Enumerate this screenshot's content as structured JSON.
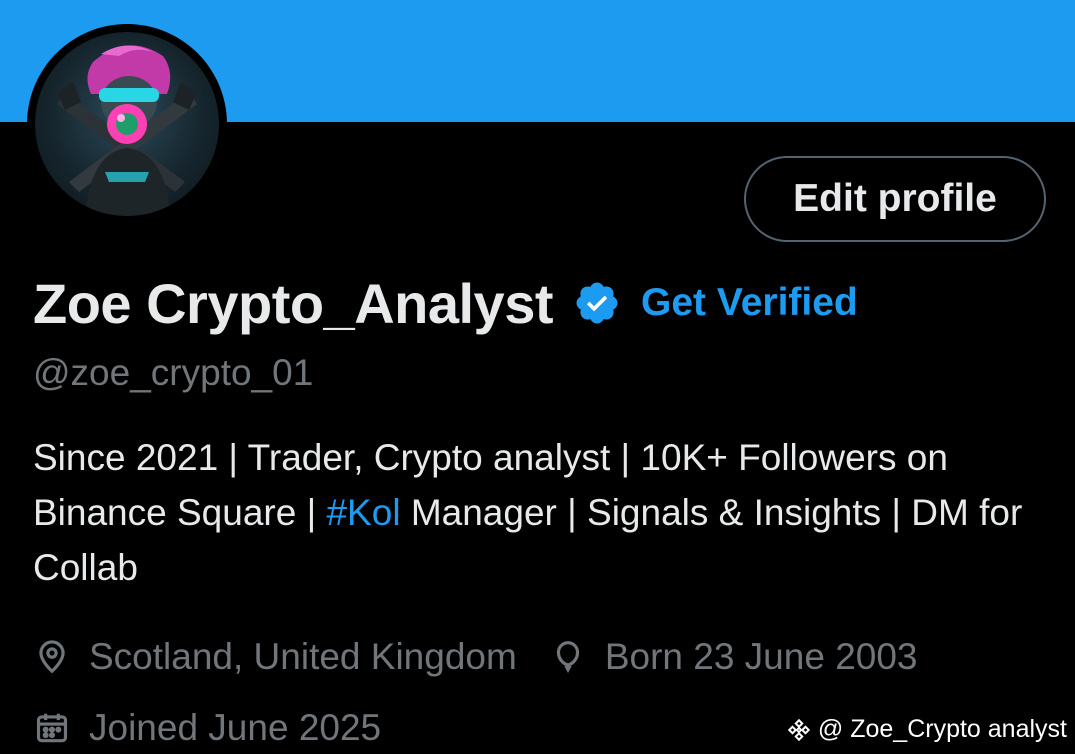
{
  "profile": {
    "display_name": "Zoe Crypto_Analyst",
    "handle": "@zoe_crypto_01",
    "get_verified_label": "Get Verified",
    "edit_profile_label": "Edit profile",
    "bio": {
      "part1": "Since 2021 | Trader, Crypto analyst | 10K+ Followers on Binance Square | ",
      "hashtag": "#Kol",
      "part2": " Manager | Signals & Insights | DM for Collab"
    },
    "location": "Scotland, United Kingdom",
    "birthday": "Born 23 June 2003",
    "joined": "Joined June 2025"
  },
  "watermark": {
    "text": "@ Zoe_Crypto analyst"
  },
  "icons": {
    "verified": "verified-badge-icon",
    "location": "location-pin-icon",
    "birthday": "balloon-icon",
    "joined": "calendar-icon",
    "watermark_logo": "binance-logo-icon"
  },
  "colors": {
    "banner": "#1d9bf0",
    "accent": "#1d9bf0",
    "background": "#000000",
    "text_primary": "#e7e9ea",
    "text_secondary": "#71767b",
    "button_border": "#536471"
  }
}
